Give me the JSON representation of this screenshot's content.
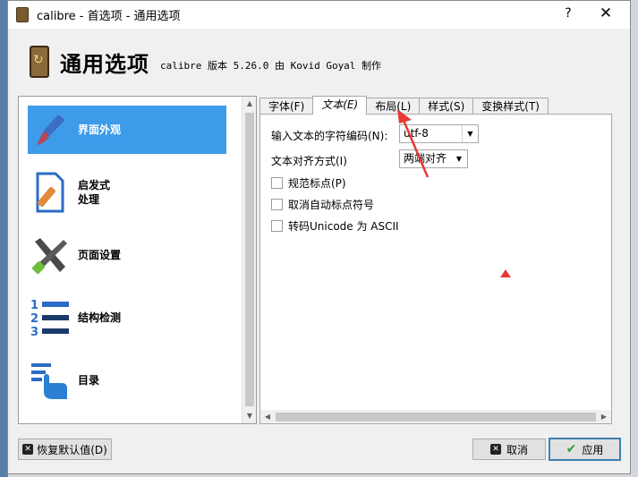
{
  "window": {
    "title": "calibre - 首选项 - 通用选项",
    "help_label": "?",
    "close_label": "✕"
  },
  "header": {
    "heading": "通用选项",
    "subtitle": "calibre 版本 5.26.0 由 Kovid Goyal 制作"
  },
  "categories": [
    {
      "label": "界面外观",
      "icon": "paintbrush-icon",
      "selected": true
    },
    {
      "label": "启发式\n处理",
      "icon": "document-tools-icon",
      "selected": false
    },
    {
      "label": "页面设置",
      "icon": "wrench-screwdriver-icon",
      "selected": false
    },
    {
      "label": "结构检测",
      "icon": "numbered-list-icon",
      "selected": false
    },
    {
      "label": "目录",
      "icon": "toc-pointer-icon",
      "selected": false
    }
  ],
  "tabs": [
    {
      "label": "字体(F)",
      "active": false
    },
    {
      "label": "文本(E)",
      "active": true
    },
    {
      "label": "布局(L)",
      "active": false
    },
    {
      "label": "样式(S)",
      "active": false
    },
    {
      "label": "变换样式(T)",
      "active": false
    }
  ],
  "text_tab": {
    "encoding_label": "输入文本的字符编码(N):",
    "encoding_value": "utf-8",
    "align_label": "文本对齐方式(I)",
    "align_value": "两端对齐",
    "checkboxes": [
      {
        "label": "规范标点(P)",
        "checked": false
      },
      {
        "label": "取消自动标点符号",
        "checked": false
      },
      {
        "label": "转码Unicode 为 ASCII",
        "checked": false
      }
    ]
  },
  "footer": {
    "restore_label": "恢复默认值(D)",
    "cancel_label": "取消",
    "apply_label": "应用"
  },
  "colors": {
    "selection": "#3d9bea",
    "annotation": "#e53935",
    "default_button_border": "#3c7fb1"
  }
}
